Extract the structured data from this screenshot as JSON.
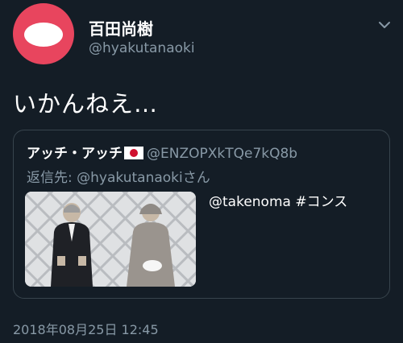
{
  "author": {
    "display_name": "百田尚樹",
    "handle": "@hyakutanaoki",
    "avatar_color": "#e8455e"
  },
  "tweet": {
    "text": "いかんねえ…",
    "timestamp": "2018年08月25日 12:45"
  },
  "quoted_tweet": {
    "display_name": "アッチ・アッチ",
    "flag_icon": "japan-flag-icon",
    "handle": "@ENZOPXkTQe7kQ8b",
    "reply_to_prefix": "返信先: ",
    "reply_to_handle": "@hyakutanaoki",
    "reply_to_suffix": "さん",
    "text": "@takenoma #コンス"
  },
  "icons": {
    "caret": "chevron-down-icon"
  },
  "colors": {
    "background": "#141d26",
    "secondary_text": "#8899a6",
    "border": "#38444d",
    "link": "#1da1f2"
  }
}
